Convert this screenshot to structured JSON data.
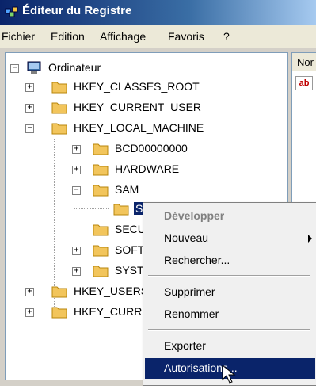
{
  "window": {
    "title": "Éditeur du Registre"
  },
  "menubar": [
    "Fichier",
    "Edition",
    "Affichage",
    "Favoris",
    "?"
  ],
  "right_pane": {
    "column_header": "Nor",
    "value_icon": "ab"
  },
  "tree": {
    "root": "Ordinateur",
    "nodes": [
      {
        "label": "HKEY_CLASSES_ROOT"
      },
      {
        "label": "HKEY_CURRENT_USER"
      },
      {
        "label": "HKEY_LOCAL_MACHINE"
      },
      {
        "label": "BCD00000000"
      },
      {
        "label": "HARDWARE"
      },
      {
        "label": "SAM"
      },
      {
        "label": "SAM"
      },
      {
        "label": "SECURITY"
      },
      {
        "label": "SOFTWARE"
      },
      {
        "label": "SYSTEM"
      },
      {
        "label": "HKEY_USERS"
      },
      {
        "label": "HKEY_CURRENT_CONFIG"
      }
    ]
  },
  "context_menu": {
    "items": [
      "Développer",
      "Nouveau",
      "Rechercher...",
      "Supprimer",
      "Renommer",
      "Exporter",
      "Autorisations..."
    ]
  }
}
